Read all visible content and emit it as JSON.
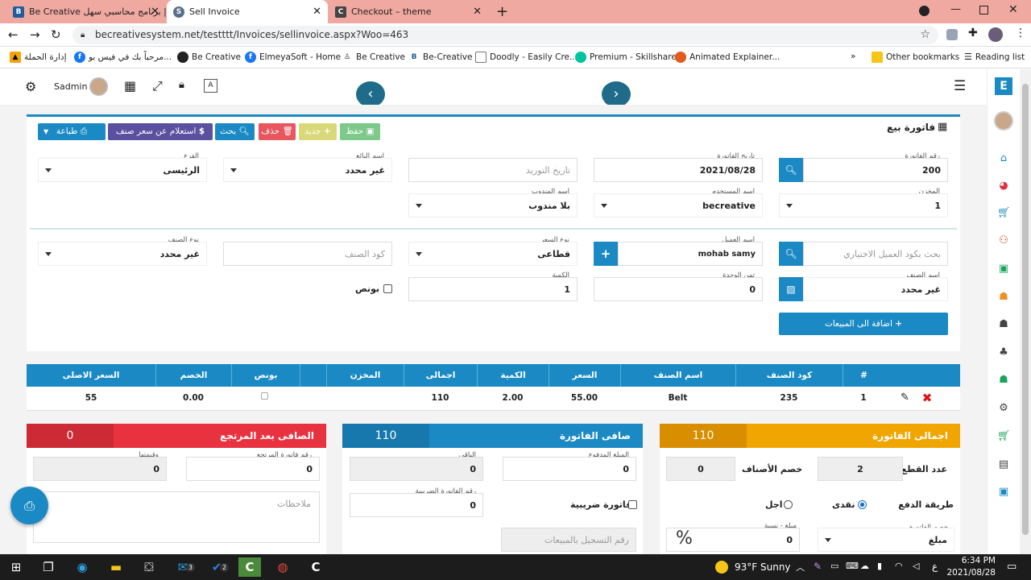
{
  "browser": {
    "tabs": [
      {
        "title": "Be Creative برنامج محاسبي سهل |",
        "favicon": "B"
      },
      {
        "title": "Sell Invoice",
        "favicon": "S"
      },
      {
        "title": "Checkout – theme",
        "favicon": "C"
      }
    ],
    "url": "becreativesystem.net/testttt/Invoices/sellinvoice.aspx?Woo=463",
    "bookmarks": [
      "إدارة الحملة",
      "مرحباً بك في فيس بو...",
      "Be Creative",
      "ElmeyaSoft - Home",
      "Be Creative",
      "Be-Creative",
      "Doodly - Easily Cre...",
      "Premium - Skillshare",
      "Animated Explainer..."
    ],
    "other_bookmarks": "Other bookmarks",
    "reading_list": "Reading list"
  },
  "header": {
    "user": "Sadmin"
  },
  "invoice": {
    "title": "فاتورة بيع",
    "buttons": {
      "print": "طباعة",
      "price_inquiry": "استعلام عن سعر صنف",
      "search": "بحث",
      "delete": "حذف",
      "new": "جديد",
      "save": "حفظ"
    },
    "fields": {
      "invoice_no_label": "رقم الفاتورة",
      "invoice_no": "200",
      "invoice_date_label": "تاريخ الفاتورة",
      "invoice_date": "2021/08/28",
      "supply_date_placeholder": "تاريخ التوريد",
      "seller_label": "اسم البائع",
      "seller": "غير محدد",
      "branch_label": "الفرع",
      "branch": "الرئيسى",
      "store_label": "المخزن",
      "store": "1",
      "user_label": "اسم المستخدم",
      "user": "becreative",
      "rep_label": "اسم المندوب",
      "rep": "بلا مندوب",
      "customer_search_placeholder": "بحث بكود العميل الاختياري",
      "customer_label": "اسم العميل",
      "customer": "mohab samy",
      "price_type_label": "نوع السعر",
      "price_type": "قطاعى",
      "item_code_placeholder": "كود الصنف",
      "item_type_label": "نوع الصنف",
      "item_type": "غير محدد",
      "item_name_label": "اسم الصنف",
      "item_name": "غير محدد",
      "unit_price_label": "ثمن الوحدة",
      "unit_price": "0",
      "qty_label": "الكمية",
      "qty": "1",
      "bonus_label": "بونص",
      "add_to_sales": "اضافة الى المبيعات"
    }
  },
  "grid": {
    "columns": [
      "#",
      "كود الصنف",
      "اسم الصنف",
      "السعر",
      "الكمية",
      "اجمالى",
      "المخزن",
      "",
      "بونص",
      "الخصم",
      "السعر الاصلى"
    ],
    "rows": [
      {
        "no": "1",
        "code": "235",
        "name": "Belt",
        "price": "55.00",
        "qty": "2.00",
        "total": "110",
        "store": "",
        "discount": "0.00",
        "orig_price": "55"
      }
    ]
  },
  "summary": {
    "total": {
      "title": "اجمالى الفاتورة",
      "value": "110"
    },
    "net": {
      "title": "صافى الفاتورة",
      "value": "110"
    },
    "after_return": {
      "title": "الصافى بعد المرتجع",
      "value": "0"
    },
    "pieces_label": "عدد القطع",
    "pieces": "2",
    "items_discount_label": "خصم الأصناف",
    "items_discount": "0",
    "payment_label": "طريقة الدفع",
    "cash": "نقدى",
    "deferred": "اجل",
    "invoice_discount_label": "خصم الفاتورة",
    "discount_type": "مبلغ",
    "amount_ratio_label": "مبلغ - نسبة",
    "amount_ratio": "0",
    "percent": "%",
    "paid_label": "المبلغ المدفوع",
    "paid": "0",
    "remaining_label": "الباقى",
    "remaining": "0",
    "tax_invoice_label": "فاتورة ضريبية",
    "tax_no_label": "رقم الفاتورة الضريبية",
    "tax_no": "0",
    "reg_no_placeholder": "رقم التسجيل بالمبيعات",
    "return_no_label": "رقم فاتورة المرتجع",
    "return_no": "0",
    "return_value_label": "وقيمتها",
    "return_value": "0",
    "notes_placeholder": "ملاحظات"
  },
  "taskbar": {
    "weather": "93°F  Sunny",
    "time": "6:34 PM",
    "date": "2021/08/28",
    "lang": "ع",
    "mail_badge": "3",
    "todo_badge": "2"
  }
}
